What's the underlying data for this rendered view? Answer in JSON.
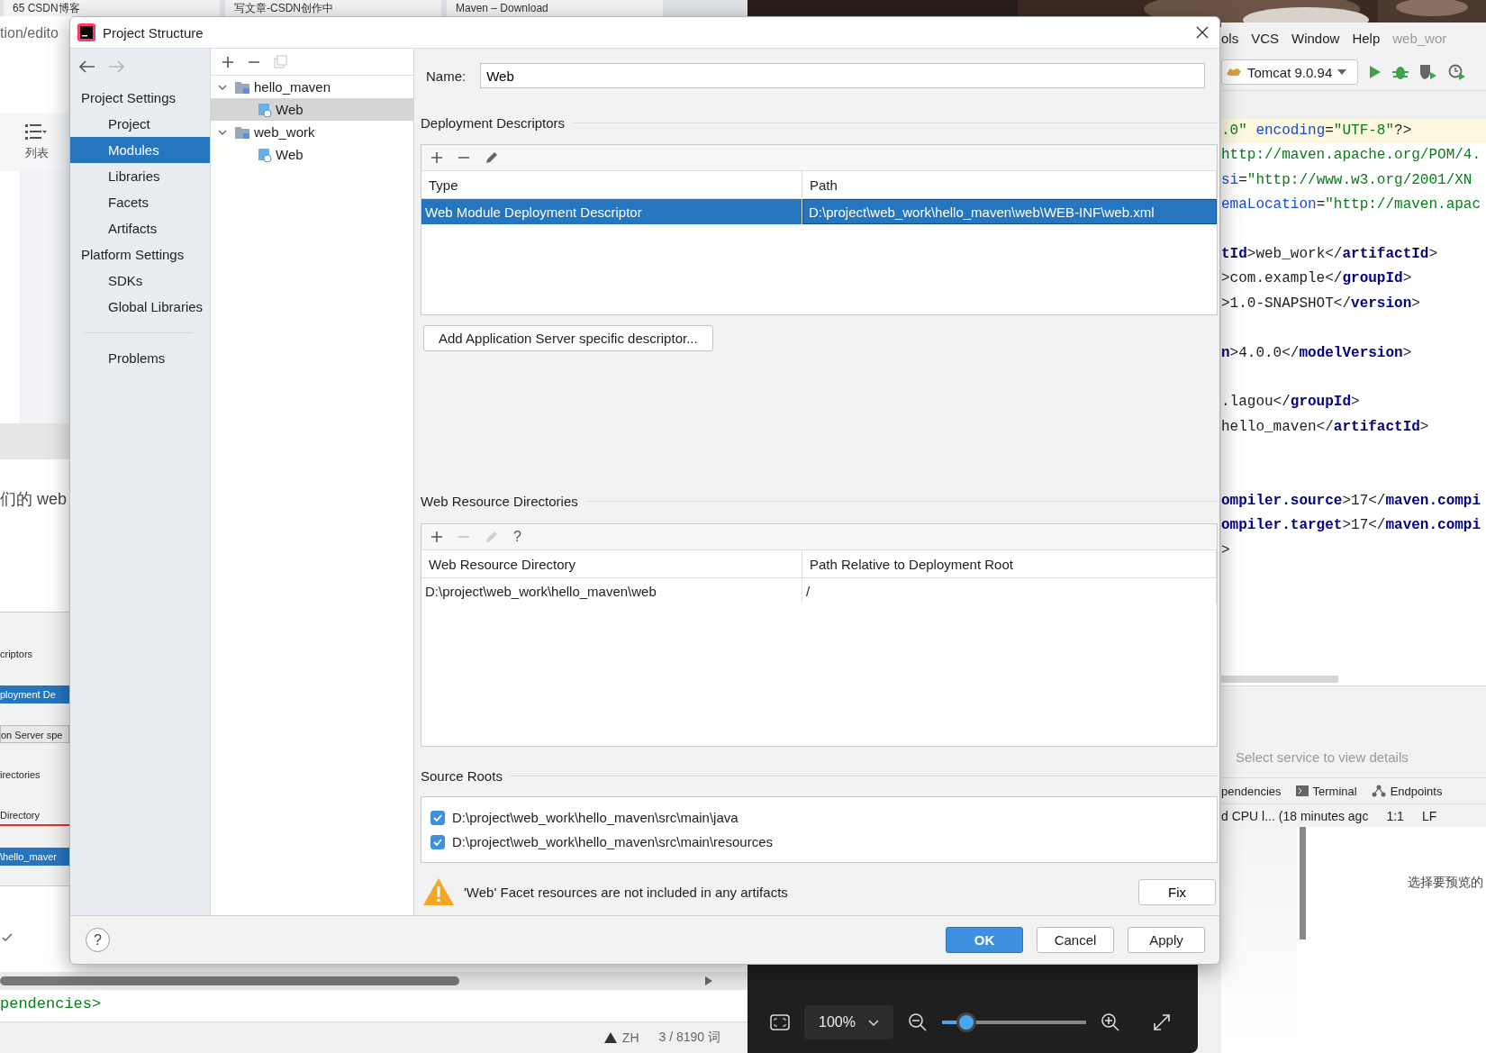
{
  "background": {
    "browser_tabs": [
      {
        "title": "65 CSDN博客"
      },
      {
        "title": "写文章-CSDN创作中"
      },
      {
        "title": "Maven – Download"
      }
    ],
    "address": "tion/edito",
    "toolbar_label": "列表",
    "article_text": "们的 web",
    "embedded_screenshot": [
      {
        "kind": "label",
        "text": "criptors"
      },
      {
        "kind": "selected",
        "text": "ployment De"
      },
      {
        "kind": "button",
        "text": "on Server spe"
      },
      {
        "kind": "label",
        "text": "irectories"
      },
      {
        "kind": "header",
        "text": "Directory"
      },
      {
        "kind": "selected",
        "text": "\\hello_maver"
      }
    ],
    "code_below": "pendencies>",
    "editor_status": {
      "language": "ZH",
      "words": "3 / 8190 词"
    },
    "ide": {
      "menu": [
        "ols",
        "VCS",
        "Window",
        "Help"
      ],
      "project": "web_wor",
      "run_config": "Tomcat 9.0.94",
      "code_lines": [
        {
          "kind": "code",
          "segments": [
            {
              "kind": "value",
              "text": ".0\""
            },
            {
              "kind": "attr",
              "text": " encoding"
            },
            {
              "kind": "plain",
              "text": "="
            },
            {
              "kind": "value",
              "text": "\"UTF-8\""
            },
            {
              "kind": "plain",
              "text": "?>"
            }
          ]
        },
        {
          "kind": "code",
          "segments": [
            {
              "kind": "value",
              "text": "http://maven.apache.org/POM/4."
            }
          ]
        },
        {
          "kind": "code",
          "segments": [
            {
              "kind": "attr",
              "text": "si"
            },
            {
              "kind": "plain",
              "text": "="
            },
            {
              "kind": "value",
              "text": "\"http://www.w3.org/2001/XN"
            }
          ]
        },
        {
          "kind": "code",
          "segments": [
            {
              "kind": "attr",
              "text": "emaLocation"
            },
            {
              "kind": "plain",
              "text": "="
            },
            {
              "kind": "value",
              "text": "\"http://maven.apac"
            }
          ]
        },
        {
          "kind": "blank"
        },
        {
          "kind": "code",
          "segments": [
            {
              "kind": "tag",
              "text": "tId"
            },
            {
              "kind": "plain",
              "text": ">web_work</"
            },
            {
              "kind": "tag",
              "text": "artifactId"
            },
            {
              "kind": "plain",
              "text": ">"
            }
          ]
        },
        {
          "kind": "code",
          "segments": [
            {
              "kind": "plain",
              "text": ">com.example</"
            },
            {
              "kind": "tag",
              "text": "groupId"
            },
            {
              "kind": "plain",
              "text": ">"
            }
          ]
        },
        {
          "kind": "code",
          "segments": [
            {
              "kind": "plain",
              "text": ">1.0-SNAPSHOT</"
            },
            {
              "kind": "tag",
              "text": "version"
            },
            {
              "kind": "plain",
              "text": ">"
            }
          ]
        },
        {
          "kind": "blank"
        },
        {
          "kind": "code",
          "segments": [
            {
              "kind": "tag",
              "text": "n"
            },
            {
              "kind": "plain",
              "text": ">4.0.0</"
            },
            {
              "kind": "tag",
              "text": "modelVersion"
            },
            {
              "kind": "plain",
              "text": ">"
            }
          ]
        },
        {
          "kind": "blank"
        },
        {
          "kind": "code",
          "segments": [
            {
              "kind": "plain",
              "text": ".lagou</"
            },
            {
              "kind": "tag",
              "text": "groupId"
            },
            {
              "kind": "plain",
              "text": ">"
            }
          ]
        },
        {
          "kind": "code",
          "segments": [
            {
              "kind": "plain",
              "text": "hello_maven</"
            },
            {
              "kind": "tag",
              "text": "artifactId"
            },
            {
              "kind": "plain",
              "text": ">"
            }
          ]
        },
        {
          "kind": "blank"
        },
        {
          "kind": "blank"
        },
        {
          "kind": "code",
          "segments": [
            {
              "kind": "tag",
              "text": "ompiler.source"
            },
            {
              "kind": "plain",
              "text": ">17</"
            },
            {
              "kind": "tag",
              "text": "maven.compi"
            }
          ]
        },
        {
          "kind": "code",
          "segments": [
            {
              "kind": "tag",
              "text": "ompiler.target"
            },
            {
              "kind": "plain",
              "text": ">17</"
            },
            {
              "kind": "tag",
              "text": "maven.compi"
            }
          ]
        },
        {
          "kind": "code",
          "segments": [
            {
              "kind": "plain",
              "text": ">"
            }
          ]
        }
      ],
      "services_hint": "Select service to view details",
      "tool_tabs": [
        {
          "kind": "plain",
          "label": "pendencies"
        },
        {
          "kind": "terminal",
          "label": "Terminal"
        },
        {
          "kind": "endpoints",
          "label": "Endpoints"
        }
      ],
      "status": [
        "d CPU l... (18 minutes agc",
        "1:1",
        "LF"
      ]
    },
    "preview_hint": "选择要预览的",
    "viewer": {
      "zoom": "100%",
      "level": 0.17
    }
  },
  "dialog": {
    "title": "Project Structure",
    "nav": [
      {
        "kind": "header",
        "label": "Project Settings"
      },
      {
        "kind": "item",
        "label": "Project",
        "selected": false
      },
      {
        "kind": "item",
        "label": "Modules",
        "selected": true
      },
      {
        "kind": "item",
        "label": "Libraries",
        "selected": false
      },
      {
        "kind": "item",
        "label": "Facets",
        "selected": false
      },
      {
        "kind": "item",
        "label": "Artifacts",
        "selected": false
      },
      {
        "kind": "header",
        "label": "Platform Settings"
      },
      {
        "kind": "item",
        "label": "SDKs",
        "selected": false
      },
      {
        "kind": "item",
        "label": "Global Libraries",
        "selected": false
      },
      {
        "kind": "separator"
      },
      {
        "kind": "item",
        "label": "Problems",
        "selected": false
      }
    ],
    "modules": [
      {
        "label": "hello_maven",
        "expanded": true,
        "selected": false,
        "children": [
          {
            "label": "Web",
            "selected": true
          }
        ]
      },
      {
        "label": "web_work",
        "expanded": true,
        "selected": false,
        "children": [
          {
            "label": "Web",
            "selected": false
          }
        ]
      }
    ],
    "name": {
      "label": "Name:",
      "value": "Web"
    },
    "deployment_descriptors": {
      "title": "Deployment Descriptors",
      "toolbar": [
        {
          "kind": "add",
          "disabled": false
        },
        {
          "kind": "remove",
          "disabled": false
        },
        {
          "kind": "edit",
          "disabled": false
        }
      ],
      "columns": [
        "Type",
        "Path"
      ],
      "rows": [
        {
          "cells": [
            "Web Module Deployment Descriptor",
            "D:\\project\\web_work\\hello_maven\\web\\WEB-INF\\web.xml"
          ],
          "selected": true
        }
      ]
    },
    "add_descriptor_button": "Add Application Server specific descriptor...",
    "web_resource_directories": {
      "title": "Web Resource Directories",
      "toolbar": [
        {
          "kind": "add",
          "disabled": false
        },
        {
          "kind": "remove",
          "disabled": true
        },
        {
          "kind": "edit",
          "disabled": true
        },
        {
          "kind": "help",
          "label": "?",
          "disabled": false
        }
      ],
      "columns": [
        "Web Resource Directory",
        "Path Relative to Deployment Root"
      ],
      "rows": [
        {
          "cells": [
            "D:\\project\\web_work\\hello_maven\\web",
            "/"
          ],
          "selected": false
        }
      ]
    },
    "source_roots": {
      "title": "Source Roots",
      "items": [
        {
          "path": "D:\\project\\web_work\\hello_maven\\src\\main\\java",
          "checked": true
        },
        {
          "path": "D:\\project\\web_work\\hello_maven\\src\\main\\resources",
          "checked": true
        }
      ]
    },
    "warning": {
      "text": "'Web' Facet resources are not included in any artifacts",
      "fix": "Fix"
    },
    "help": "?",
    "buttons": [
      {
        "label": "OK",
        "primary": true
      },
      {
        "label": "Cancel",
        "primary": false
      },
      {
        "label": "Apply",
        "primary": false
      }
    ]
  }
}
